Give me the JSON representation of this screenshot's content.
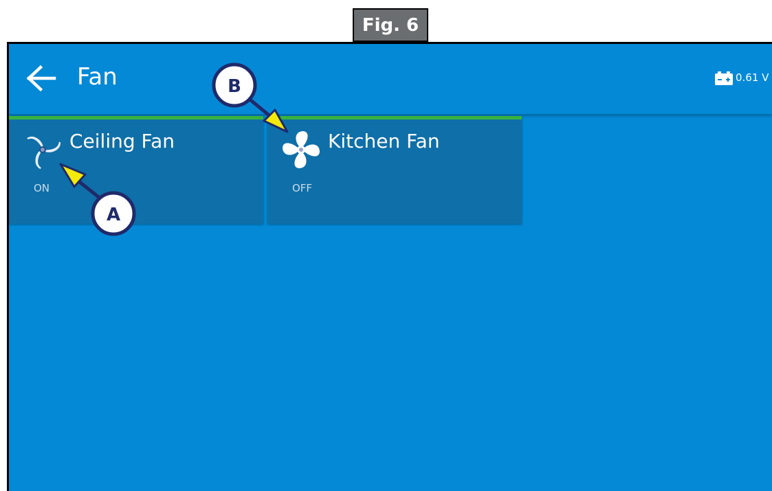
{
  "figure": {
    "label": "Fig. 6"
  },
  "appbar": {
    "title": "Fan",
    "back_icon": "arrow-left-icon",
    "battery_icon": "battery-icon",
    "voltage": "0.61 V"
  },
  "tiles": [
    {
      "name": "Ceiling Fan",
      "state": "ON",
      "icon": "fan-icon",
      "active": true
    },
    {
      "name": "Kitchen Fan",
      "state": "OFF",
      "icon": "fan-icon",
      "active": false
    }
  ],
  "callouts": [
    {
      "label": "A"
    },
    {
      "label": "B"
    }
  ],
  "colors": {
    "background": "#0489d6",
    "tile": "#0f6fa8",
    "active_bar": "#37b33e",
    "callout_fill": "#ffffff",
    "callout_border": "#1f2a6b",
    "arrow_fill": "#f4ea0a"
  }
}
